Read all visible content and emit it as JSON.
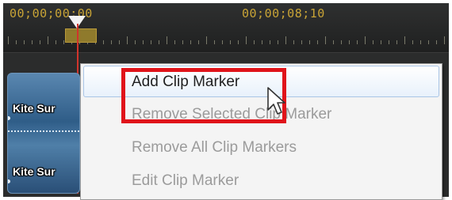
{
  "timeline": {
    "timecode_start": "00;00;00;00",
    "timecode_mid": "00;00;08;10"
  },
  "clip": {
    "label_top": "Kite Sur",
    "label_bottom": "Kite Sur"
  },
  "context_menu": {
    "items": [
      {
        "label": "Add Clip Marker",
        "enabled": true,
        "hovered": true
      },
      {
        "label": "Remove Selected Clip Marker",
        "enabled": false
      },
      {
        "label": "Remove All Clip Markers",
        "enabled": false
      },
      {
        "label": "Edit Clip Marker",
        "enabled": false
      }
    ]
  },
  "colors": {
    "timecode": "#c9a436",
    "highlight": "#e0141a",
    "playhead_line": "#d0342c",
    "disabled_text": "#9b9b9b"
  },
  "icons": {
    "playhead": "playhead-triangle-icon",
    "cursor": "mouse-pointer-icon"
  }
}
